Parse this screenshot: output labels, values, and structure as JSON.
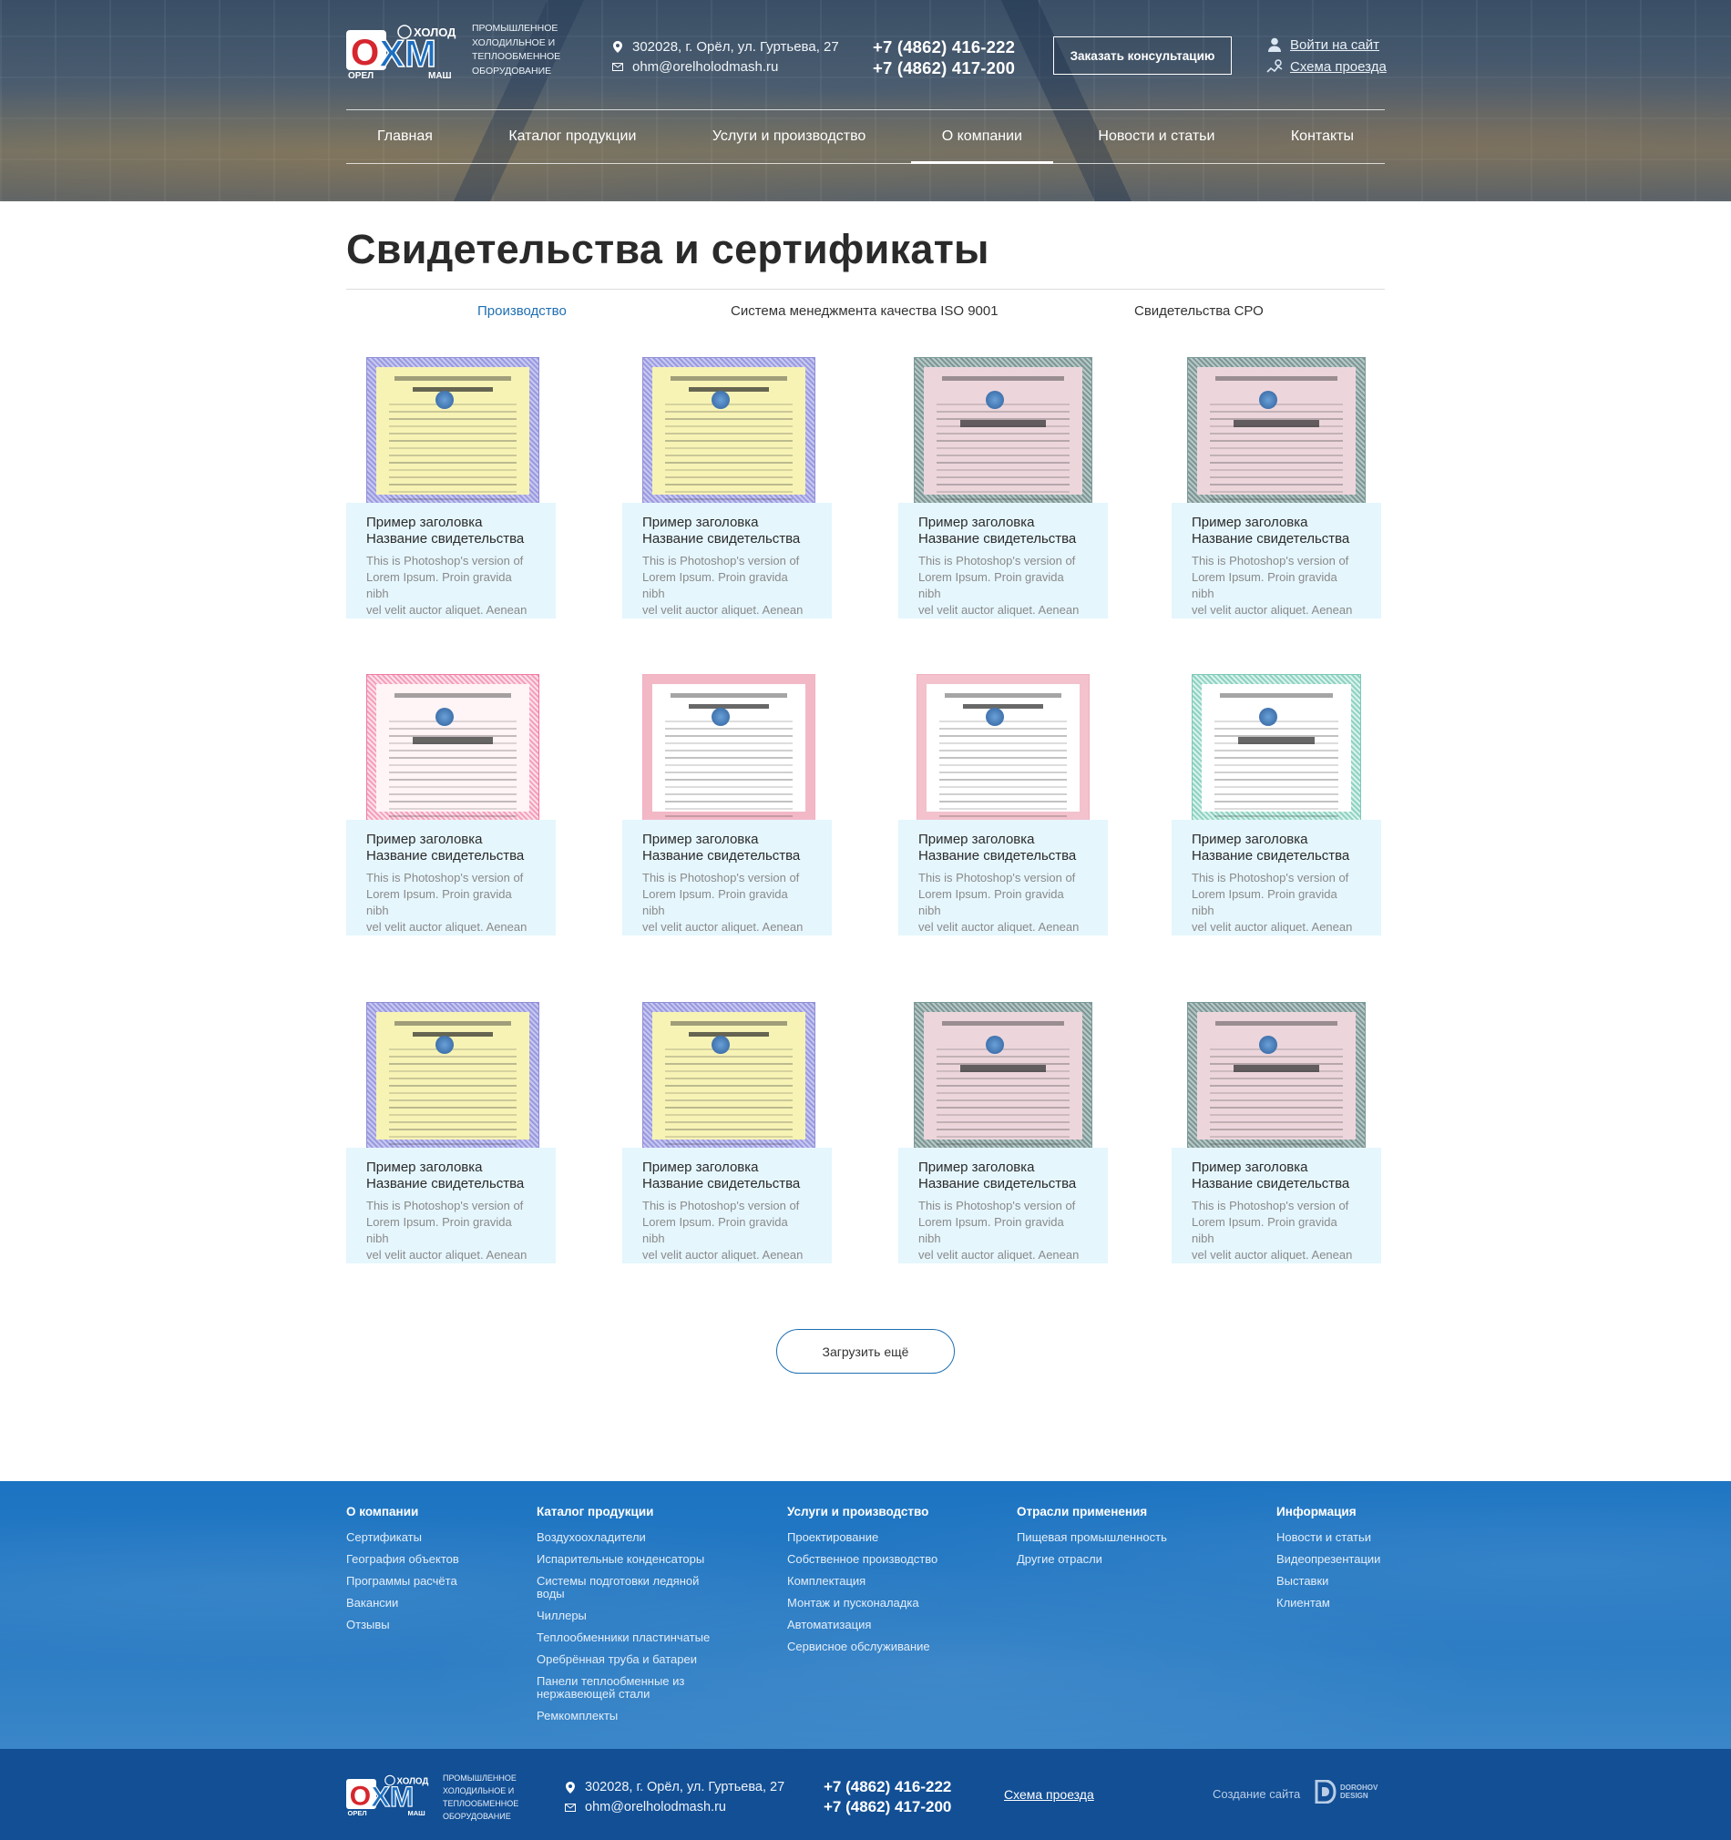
{
  "header": {
    "logo_brand": "ОХМ",
    "logo_city": "ОРЕЛ",
    "logo_word_top": "ХОЛОД",
    "logo_word_bottom": "МАШ",
    "tagline": "ПРОМЫШЛЕННОЕ ХОЛОДИЛЬНОЕ И ТЕПЛООБМЕННОЕ ОБОРУДОВАНИЕ",
    "address": "302028, г. Орёл, ул. Гуртьева, 27",
    "email": "ohm@orelholodmash.ru",
    "phone1": "+7 (4862) 416-222",
    "phone2": "+7 (4862) 417-200",
    "consult_button": "Заказать консультацию",
    "login_link": "Войти на сайт",
    "map_link": "Схема проезда"
  },
  "nav": {
    "items": [
      {
        "label": "Главная"
      },
      {
        "label": "Каталог продукции"
      },
      {
        "label": "Услуги и производство"
      },
      {
        "label": "О компании",
        "active": true
      },
      {
        "label": "Новости и статьи"
      },
      {
        "label": "Контакты"
      }
    ]
  },
  "page": {
    "title": "Свидетельства и сертификаты",
    "tabs": [
      {
        "label": "Производство",
        "active": true
      },
      {
        "label": "Система менеджмента качества ISO 9001"
      },
      {
        "label": "Свидетельства СРО"
      }
    ],
    "card_title_1": "Пример заголовка",
    "card_title_2": "Название свидетельства",
    "card_desc_1": "This is Photoshop's version  of",
    "card_desc_2": "Lorem Ipsum. Proin gravida nibh",
    "card_desc_3": "vel velit auctor aliquet. Aenean",
    "load_more": "Загрузить ещё"
  },
  "footer": {
    "columns": [
      {
        "title": "О компании",
        "items": [
          "Сертификаты",
          "География объектов",
          "Программы расчёта",
          "Вакансии",
          "Отзывы"
        ]
      },
      {
        "title": "Каталог продукции",
        "items": [
          "Воздухоохладители",
          "Испарительные конденсаторы",
          "Системы подготовки ледяной воды",
          "Чиллеры",
          "Теплообменники пластинчатые",
          "Оребрённая труба и батареи",
          "Панели теплообменные из нержавеющей стали",
          "Ремкомплекты"
        ]
      },
      {
        "title": "Услуги и производство",
        "items": [
          "Проектирование",
          "Собственное производство",
          "Комплектация",
          "Монтаж и пусконаладка",
          "Автоматизация",
          "Сервисное обслуживание"
        ]
      },
      {
        "title": "Отрасли применения",
        "items": [
          "Пищевая промышленность",
          "Другие отрасли"
        ]
      },
      {
        "title": "Информация",
        "items": [
          "Новости и статьи",
          "Видеопрезентации",
          "Выставки",
          "Клиентам"
        ]
      }
    ],
    "made_by": "Создание сайта",
    "studio": "DOROHOV DESIGN",
    "studio_line1": "DOROHOV",
    "studio_line2": "DESIGN"
  },
  "colors": {
    "accent": "#1e6fb3",
    "card_bg": "#e5f6fd",
    "footer_top": "#1c74c2",
    "footer_bottom": "#124f95"
  }
}
